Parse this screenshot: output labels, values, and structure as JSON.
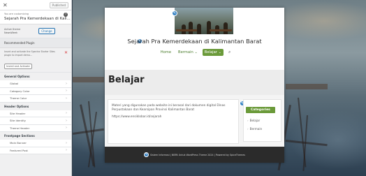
{
  "customizer": {
    "close_icon": "close-icon",
    "publish_label": "Published",
    "info_small": "You are customizing",
    "info_title": "Sejarah Pra Kemerdekaan di Kali...",
    "active_theme_label": "Active theme",
    "active_theme_name": "NewsWeek",
    "change_label": "Change",
    "recommended_header": "Recommended Plugin",
    "notice_text": "Insert and activate the Spectra Starter Sites plugin to import demo...",
    "notice_button": "Install and Activate",
    "groups": [
      {
        "title": "General Options",
        "items": [
          "Global",
          "Category Color",
          "Theme Color"
        ]
      },
      {
        "title": "Header Options",
        "items": [
          "Site Header",
          "Site Identity",
          "Theme Header"
        ]
      },
      {
        "title": "Frontpage Sections",
        "items": [
          "Main Banner",
          "Featured Post"
        ]
      }
    ]
  },
  "site": {
    "title": "Sejarah Pra Kemerdekaan di Kalimantan Barat",
    "nav": [
      {
        "label": "Home",
        "has_dropdown": false,
        "active": false
      },
      {
        "label": "Bermain",
        "has_dropdown": true,
        "active": false
      },
      {
        "label": "Belajar",
        "has_dropdown": true,
        "active": true
      }
    ],
    "search_icon": "search-icon",
    "page_title": "Belajar",
    "post_text": "Materi yang digunakan pada website ini berasal dari dokumen digital Dinas Perpustakaan dan Kearsipan Provinsi Kalimantan Barat",
    "post_link": "https://www.ensiklobar.id/sejarah",
    "sidebar_title": "Categories",
    "categories": [
      "Belajar",
      "Bermain"
    ],
    "footer_text": "Sistem Informasi | NBPA Untuk WordPress Theme 2024 | Powered by SpiceThemes"
  },
  "colors": {
    "accent_green": "#6b9a3a",
    "customizer_blue": "#2271b1",
    "edit_pin_blue": "#3582c4",
    "footer_bg": "#2b2b2b"
  }
}
